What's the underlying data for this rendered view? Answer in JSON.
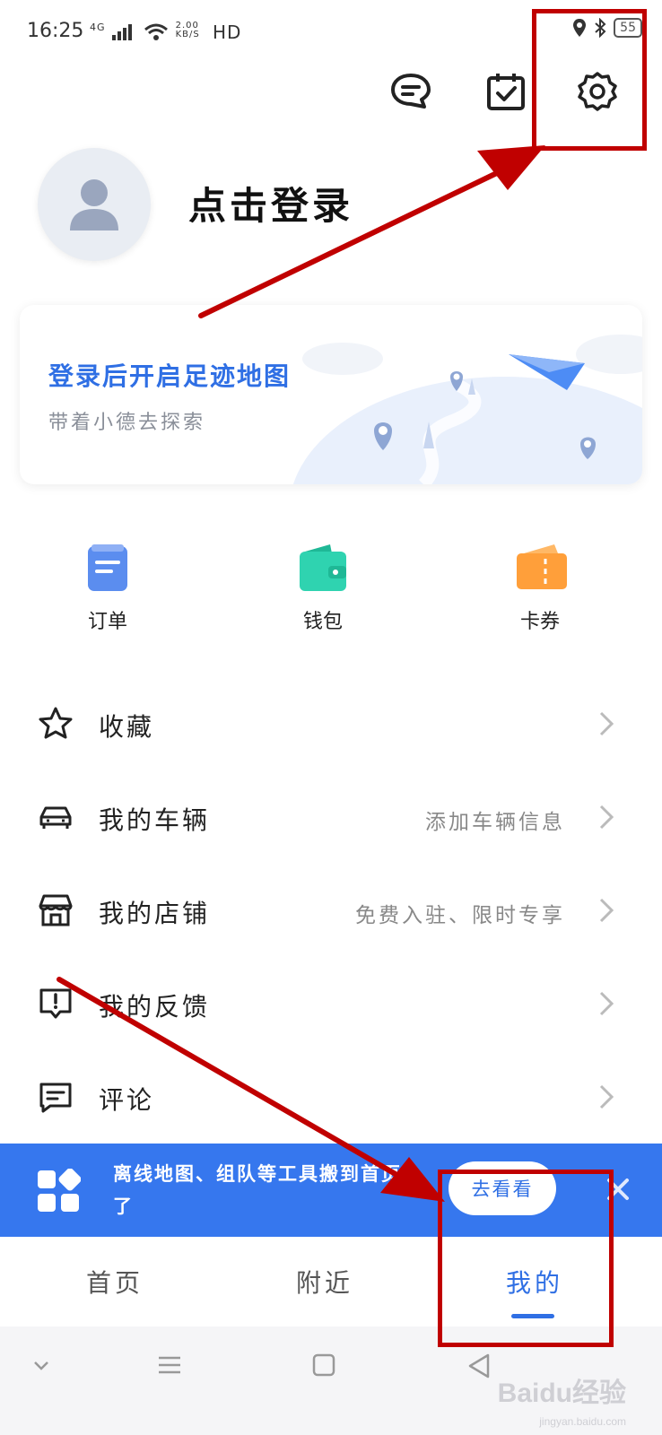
{
  "status_bar": {
    "time": "16:25",
    "network": "4G",
    "speed": "2.00 KB/S",
    "hd": "HD",
    "battery": "55"
  },
  "top_actions": {
    "icons": [
      "message-icon",
      "checkin-calendar-icon",
      "gear-icon"
    ]
  },
  "profile": {
    "login_text": "点击登录"
  },
  "footprint_card": {
    "title": "登录后开启足迹地图",
    "subtitle": "带着小德去探索"
  },
  "quick_entries": [
    {
      "label": "订单",
      "icon": "order-icon",
      "color": "#5b8def"
    },
    {
      "label": "钱包",
      "icon": "wallet-icon",
      "color": "#2fd3b0"
    },
    {
      "label": "卡券",
      "icon": "coupon-icon",
      "color": "#ff9f3a"
    }
  ],
  "menu": [
    {
      "label": "收藏",
      "sub": "",
      "icon": "star-icon"
    },
    {
      "label": "我的车辆",
      "sub": "添加车辆信息",
      "icon": "car-icon"
    },
    {
      "label": "我的店铺",
      "sub": "免费入驻、限时专享",
      "icon": "store-icon"
    },
    {
      "label": "我的反馈",
      "sub": "",
      "icon": "feedback-icon"
    },
    {
      "label": "评论",
      "sub": "",
      "icon": "comment-icon"
    }
  ],
  "banner": {
    "text": "离线地图、组队等工具搬到首页了",
    "button": "去看看"
  },
  "tabs": [
    {
      "label": "首页",
      "active": false
    },
    {
      "label": "附近",
      "active": false
    },
    {
      "label": "我的",
      "active": true
    }
  ],
  "colors": {
    "accent": "#2f6fe4",
    "banner": "#3677ee",
    "annotation": "#c00000"
  },
  "watermark": {
    "text": "Baidu经验",
    "sub": "jingyan.baidu.com"
  }
}
